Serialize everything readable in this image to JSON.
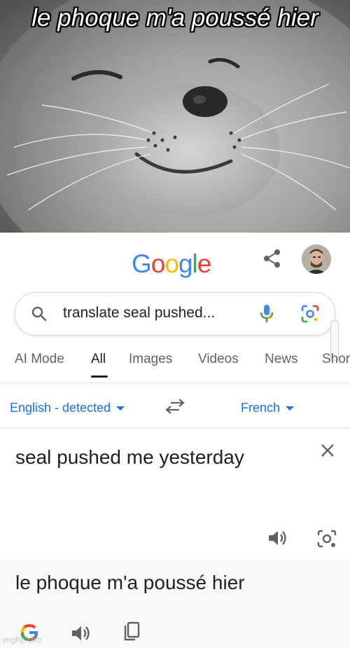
{
  "meme": {
    "caption": "le phoque m'a poussé hier"
  },
  "header": {
    "logo_letters": [
      {
        "char": "G",
        "color": "#4285F4"
      },
      {
        "char": "o",
        "color": "#EA4335"
      },
      {
        "char": "o",
        "color": "#FBBC05"
      },
      {
        "char": "g",
        "color": "#4285F4"
      },
      {
        "char": "l",
        "color": "#34A853"
      },
      {
        "char": "e",
        "color": "#EA4335"
      }
    ]
  },
  "search": {
    "query": "translate seal pushed..."
  },
  "tabs": [
    {
      "label": "AI Mode"
    },
    {
      "label": "All"
    },
    {
      "label": "Images"
    },
    {
      "label": "Videos"
    },
    {
      "label": "News"
    },
    {
      "label": "Shor"
    }
  ],
  "translator": {
    "source_lang": "English - detected",
    "target_lang": "French",
    "source_text": "seal pushed me yesterday",
    "result_text": "le phoque m'a poussé hier"
  },
  "watermark": "imgflip.com",
  "colors": {
    "accent": "#1a73e8",
    "text": "#202124",
    "muted": "#5f6368"
  }
}
